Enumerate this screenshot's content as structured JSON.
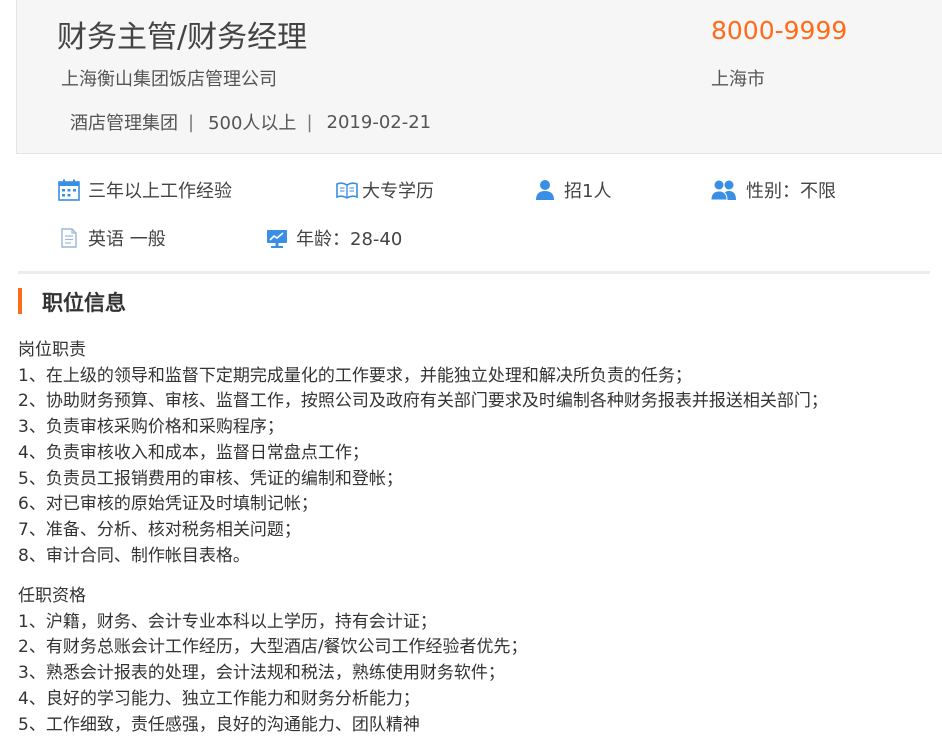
{
  "job": {
    "title": "财务主管/财务经理",
    "salary": "8000-9999",
    "company": "上海衡山集团饭店管理公司",
    "city": "上海市",
    "industry": "酒店管理集团",
    "company_size": "500人以上",
    "date": "2019-02-21",
    "separator": "|"
  },
  "attributes": [
    {
      "icon": "calendar-icon",
      "label": "三年以上工作经验"
    },
    {
      "icon": "book-icon",
      "label": "大专学历"
    },
    {
      "icon": "person-icon",
      "label": "招1人"
    },
    {
      "icon": "users-icon",
      "label": "性别：不限"
    },
    {
      "icon": "document-icon",
      "label": "英语 一般"
    },
    {
      "icon": "monitor-chart-icon",
      "label": "年龄：28-40"
    }
  ],
  "section": {
    "title": "职位信息"
  },
  "duties": {
    "heading": "岗位职责",
    "items": [
      "1、在上级的领导和监督下定期完成量化的工作要求，并能独立处理和解决所负责的任务；",
      "2、协助财务预算、审核、监督工作，按照公司及政府有关部门要求及时编制各种财务报表并报送相关部门；",
      "3、负责审核采购价格和采购程序；",
      "4、负责审核收入和成本，监督日常盘点工作；",
      "5、负责员工报销费用的审核、凭证的编制和登帐；",
      "6、对已审核的原始凭证及时填制记帐；",
      "7、准备、分析、核对税务相关问题；",
      "8、审计合同、制作帐目表格。"
    ]
  },
  "requirements": {
    "heading": "任职资格",
    "items": [
      "1、沪籍，财务、会计专业本科以上学历，持有会计证；",
      "2、有财务总账会计工作经历，大型酒店/餐饮公司工作经验者优先；",
      "3、熟悉会计报表的处理，会计法规和税法，熟练使用财务软件；",
      "4、良好的学习能力、独立工作能力和财务分析能力；",
      "5、工作细致，责任感强，良好的沟通能力、团队精神"
    ]
  },
  "colors": {
    "accent": "#ff6b1a",
    "icon_blue": "#3a8ee6",
    "header_bg": "#f6f6f6"
  }
}
